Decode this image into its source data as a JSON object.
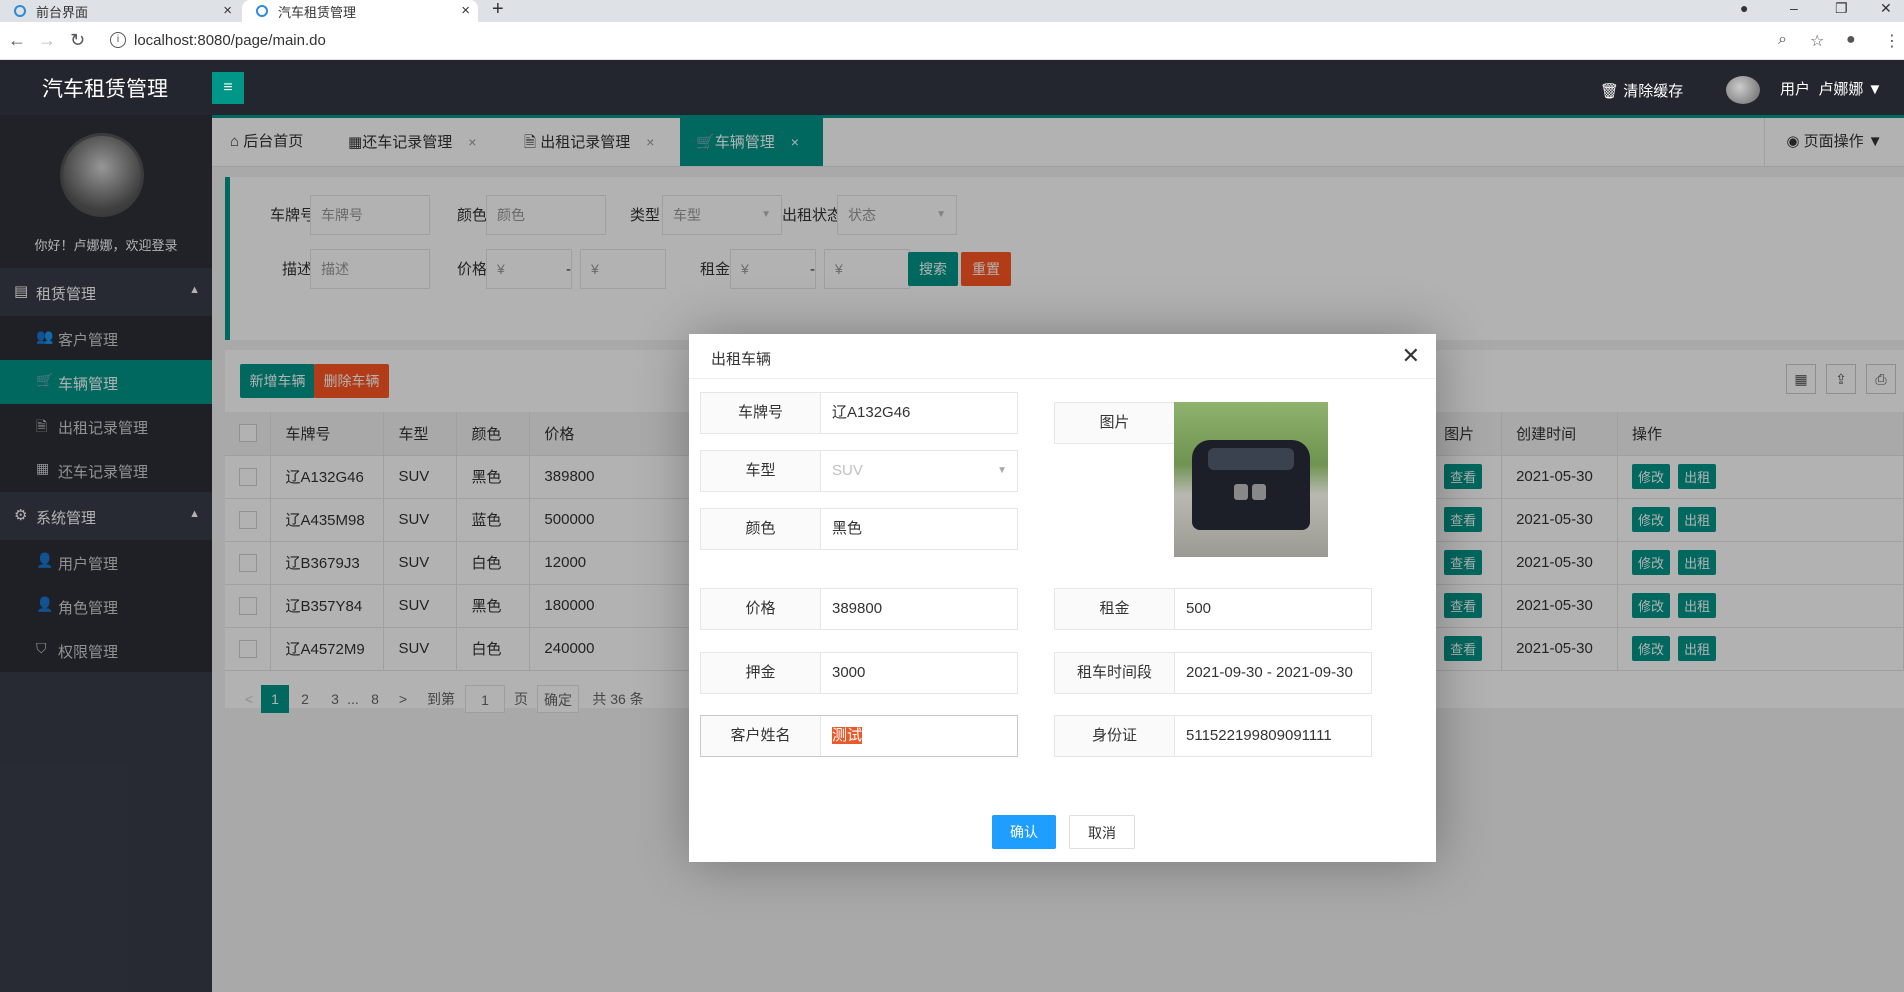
{
  "browser": {
    "tabs": [
      {
        "title": "前台界面",
        "close": "×"
      },
      {
        "title": "汽车租赁管理",
        "close": "×"
      }
    ],
    "new_tab": "+",
    "url": "localhost:8080/page/main.do"
  },
  "header": {
    "app_title": "汽车租赁管理",
    "menu_icon": "≡",
    "clear_cache": "清除缓存",
    "user_label": "用户",
    "user_name": "卢娜娜"
  },
  "sidebar": {
    "welcome": "你好！卢娜娜，欢迎登录",
    "groups": [
      {
        "label": "租赁管理",
        "items": [
          {
            "label": "客户管理",
            "icon": "users-icon"
          },
          {
            "label": "车辆管理",
            "icon": "cart-icon",
            "active": true
          },
          {
            "label": "出租记录管理",
            "icon": "file-icon"
          },
          {
            "label": "还车记录管理",
            "icon": "calendar-icon"
          }
        ]
      },
      {
        "label": "系统管理",
        "items": [
          {
            "label": "用户管理",
            "icon": "user-icon"
          },
          {
            "label": "角色管理",
            "icon": "person-icon"
          },
          {
            "label": "权限管理",
            "icon": "shield-icon"
          }
        ]
      }
    ]
  },
  "content_tabs": [
    {
      "label": "后台首页"
    },
    {
      "label": "还车记录管理",
      "close": "×"
    },
    {
      "label": "出租记录管理",
      "close": "×"
    },
    {
      "label": "车辆管理",
      "close": "×",
      "active": true
    }
  ],
  "page_ops": "页面操作",
  "filter": {
    "plate_label": "车牌号",
    "plate_placeholder": "车牌号",
    "color_label": "颜色",
    "color_placeholder": "颜色",
    "type_label": "类型",
    "type_placeholder": "车型",
    "status_label": "出租状态",
    "status_placeholder": "状态",
    "desc_label": "描述",
    "desc_placeholder": "描述",
    "price_label": "价格",
    "rent_label": "租金",
    "currency": "¥",
    "dash": "-",
    "search": "搜索",
    "reset": "重置"
  },
  "toolbar": {
    "add": "新增车辆",
    "delete": "删除车辆"
  },
  "table": {
    "headers": [
      "车牌号",
      "车型",
      "颜色",
      "价格",
      "图片",
      "创建时间",
      "操作"
    ],
    "rows": [
      {
        "plate": "辽A132G46",
        "type": "SUV",
        "color": "黑色",
        "price": "389800",
        "date": "2021-05-30"
      },
      {
        "plate": "辽A435M98",
        "type": "SUV",
        "color": "蓝色",
        "price": "500000",
        "date": "2021-05-30"
      },
      {
        "plate": "辽B3679J3",
        "type": "SUV",
        "color": "白色",
        "price": "12000",
        "date": "2021-05-30"
      },
      {
        "plate": "辽B357Y84",
        "type": "SUV",
        "color": "黑色",
        "price": "180000",
        "date": "2021-05-30"
      },
      {
        "plate": "辽A4572M9",
        "type": "SUV",
        "color": "白色",
        "price": "240000",
        "date": "2021-05-30"
      }
    ],
    "view": "查看",
    "edit": "修改",
    "rent": "出租"
  },
  "pager": {
    "prev": "<",
    "pages": [
      "1",
      "2",
      "3",
      "...",
      "8"
    ],
    "next": ">",
    "goto": "到第",
    "page_input": "1",
    "page_unit": "页",
    "confirm": "确定",
    "total": "共 36 条"
  },
  "modal": {
    "title": "出租车辆",
    "fields": {
      "plate": {
        "label": "车牌号",
        "value": "辽A132G46"
      },
      "type": {
        "label": "车型",
        "value": "SUV"
      },
      "color": {
        "label": "颜色",
        "value": "黑色"
      },
      "image": {
        "label": "图片"
      },
      "price": {
        "label": "价格",
        "value": "389800"
      },
      "rent": {
        "label": "租金",
        "value": "500"
      },
      "deposit": {
        "label": "押金",
        "value": "3000"
      },
      "period": {
        "label": "租车时间段",
        "value": "2021-09-30 - 2021-09-30"
      },
      "customer": {
        "label": "客户姓名",
        "value": "测试"
      },
      "idcard": {
        "label": "身份证",
        "value": "511522199809091111"
      }
    },
    "confirm": "确认",
    "cancel": "取消"
  },
  "colors": {
    "teal": "#009688",
    "orange": "#FF5722",
    "blue": "#1E9FFF",
    "dark": "#23262E"
  }
}
